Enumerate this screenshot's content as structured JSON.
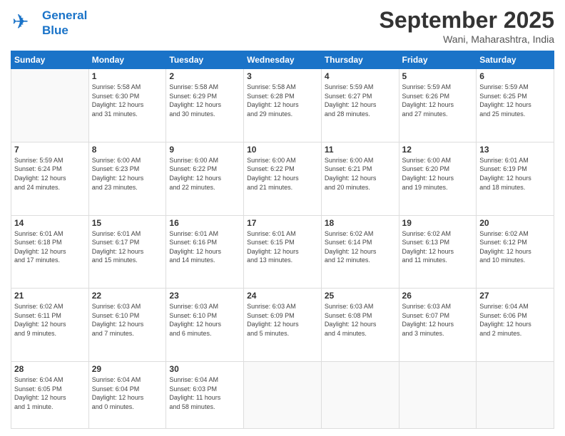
{
  "header": {
    "logo_line1": "General",
    "logo_line2": "Blue",
    "month": "September 2025",
    "location": "Wani, Maharashtra, India"
  },
  "weekdays": [
    "Sunday",
    "Monday",
    "Tuesday",
    "Wednesday",
    "Thursday",
    "Friday",
    "Saturday"
  ],
  "weeks": [
    [
      {
        "day": "",
        "info": ""
      },
      {
        "day": "1",
        "info": "Sunrise: 5:58 AM\nSunset: 6:30 PM\nDaylight: 12 hours\nand 31 minutes."
      },
      {
        "day": "2",
        "info": "Sunrise: 5:58 AM\nSunset: 6:29 PM\nDaylight: 12 hours\nand 30 minutes."
      },
      {
        "day": "3",
        "info": "Sunrise: 5:58 AM\nSunset: 6:28 PM\nDaylight: 12 hours\nand 29 minutes."
      },
      {
        "day": "4",
        "info": "Sunrise: 5:59 AM\nSunset: 6:27 PM\nDaylight: 12 hours\nand 28 minutes."
      },
      {
        "day": "5",
        "info": "Sunrise: 5:59 AM\nSunset: 6:26 PM\nDaylight: 12 hours\nand 27 minutes."
      },
      {
        "day": "6",
        "info": "Sunrise: 5:59 AM\nSunset: 6:25 PM\nDaylight: 12 hours\nand 25 minutes."
      }
    ],
    [
      {
        "day": "7",
        "info": "Sunrise: 5:59 AM\nSunset: 6:24 PM\nDaylight: 12 hours\nand 24 minutes."
      },
      {
        "day": "8",
        "info": "Sunrise: 6:00 AM\nSunset: 6:23 PM\nDaylight: 12 hours\nand 23 minutes."
      },
      {
        "day": "9",
        "info": "Sunrise: 6:00 AM\nSunset: 6:22 PM\nDaylight: 12 hours\nand 22 minutes."
      },
      {
        "day": "10",
        "info": "Sunrise: 6:00 AM\nSunset: 6:22 PM\nDaylight: 12 hours\nand 21 minutes."
      },
      {
        "day": "11",
        "info": "Sunrise: 6:00 AM\nSunset: 6:21 PM\nDaylight: 12 hours\nand 20 minutes."
      },
      {
        "day": "12",
        "info": "Sunrise: 6:00 AM\nSunset: 6:20 PM\nDaylight: 12 hours\nand 19 minutes."
      },
      {
        "day": "13",
        "info": "Sunrise: 6:01 AM\nSunset: 6:19 PM\nDaylight: 12 hours\nand 18 minutes."
      }
    ],
    [
      {
        "day": "14",
        "info": "Sunrise: 6:01 AM\nSunset: 6:18 PM\nDaylight: 12 hours\nand 17 minutes."
      },
      {
        "day": "15",
        "info": "Sunrise: 6:01 AM\nSunset: 6:17 PM\nDaylight: 12 hours\nand 15 minutes."
      },
      {
        "day": "16",
        "info": "Sunrise: 6:01 AM\nSunset: 6:16 PM\nDaylight: 12 hours\nand 14 minutes."
      },
      {
        "day": "17",
        "info": "Sunrise: 6:01 AM\nSunset: 6:15 PM\nDaylight: 12 hours\nand 13 minutes."
      },
      {
        "day": "18",
        "info": "Sunrise: 6:02 AM\nSunset: 6:14 PM\nDaylight: 12 hours\nand 12 minutes."
      },
      {
        "day": "19",
        "info": "Sunrise: 6:02 AM\nSunset: 6:13 PM\nDaylight: 12 hours\nand 11 minutes."
      },
      {
        "day": "20",
        "info": "Sunrise: 6:02 AM\nSunset: 6:12 PM\nDaylight: 12 hours\nand 10 minutes."
      }
    ],
    [
      {
        "day": "21",
        "info": "Sunrise: 6:02 AM\nSunset: 6:11 PM\nDaylight: 12 hours\nand 9 minutes."
      },
      {
        "day": "22",
        "info": "Sunrise: 6:03 AM\nSunset: 6:10 PM\nDaylight: 12 hours\nand 7 minutes."
      },
      {
        "day": "23",
        "info": "Sunrise: 6:03 AM\nSunset: 6:10 PM\nDaylight: 12 hours\nand 6 minutes."
      },
      {
        "day": "24",
        "info": "Sunrise: 6:03 AM\nSunset: 6:09 PM\nDaylight: 12 hours\nand 5 minutes."
      },
      {
        "day": "25",
        "info": "Sunrise: 6:03 AM\nSunset: 6:08 PM\nDaylight: 12 hours\nand 4 minutes."
      },
      {
        "day": "26",
        "info": "Sunrise: 6:03 AM\nSunset: 6:07 PM\nDaylight: 12 hours\nand 3 minutes."
      },
      {
        "day": "27",
        "info": "Sunrise: 6:04 AM\nSunset: 6:06 PM\nDaylight: 12 hours\nand 2 minutes."
      }
    ],
    [
      {
        "day": "28",
        "info": "Sunrise: 6:04 AM\nSunset: 6:05 PM\nDaylight: 12 hours\nand 1 minute."
      },
      {
        "day": "29",
        "info": "Sunrise: 6:04 AM\nSunset: 6:04 PM\nDaylight: 12 hours\nand 0 minutes."
      },
      {
        "day": "30",
        "info": "Sunrise: 6:04 AM\nSunset: 6:03 PM\nDaylight: 11 hours\nand 58 minutes."
      },
      {
        "day": "",
        "info": ""
      },
      {
        "day": "",
        "info": ""
      },
      {
        "day": "",
        "info": ""
      },
      {
        "day": "",
        "info": ""
      }
    ]
  ]
}
